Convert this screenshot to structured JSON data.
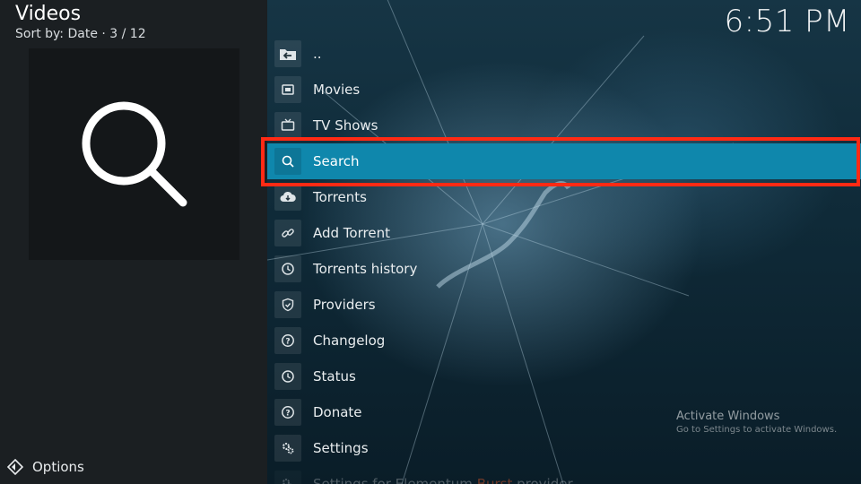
{
  "header": {
    "title": "Videos",
    "subtitle": "Sort by: Date  ·  3 / 12"
  },
  "clock": "6:51 PM",
  "thumbnail": {
    "icon": "search-icon"
  },
  "options": {
    "label": "Options",
    "icon": "options-icon"
  },
  "list": {
    "items": [
      {
        "label": "..",
        "icon": "folder-back-icon"
      },
      {
        "label": "Movies",
        "icon": "movies-icon"
      },
      {
        "label": "TV Shows",
        "icon": "tv-icon"
      },
      {
        "label": "Search",
        "icon": "search-icon",
        "focused": true
      },
      {
        "label": "Torrents",
        "icon": "cloud-download-icon"
      },
      {
        "label": "Add Torrent",
        "icon": "link-icon"
      },
      {
        "label": "Torrents history",
        "icon": "clock-icon"
      },
      {
        "label": "Providers",
        "icon": "shield-icon"
      },
      {
        "label": "Changelog",
        "icon": "help-icon"
      },
      {
        "label": "Status",
        "icon": "clock-icon"
      },
      {
        "label": "Donate",
        "icon": "help-icon"
      },
      {
        "label": "Settings",
        "icon": "gears-icon"
      },
      {
        "label_pre": "Settings for Elementum ",
        "label_accent": "Burst",
        "label_post": " provider",
        "icon": "gears-icon"
      }
    ]
  },
  "watermark": {
    "line1": "Activate Windows",
    "line2": "Go to Settings to activate Windows."
  },
  "colors": {
    "focus": "#0f87ac",
    "highlight_border": "#ff2a14",
    "left_panel": "#1b1f22"
  }
}
